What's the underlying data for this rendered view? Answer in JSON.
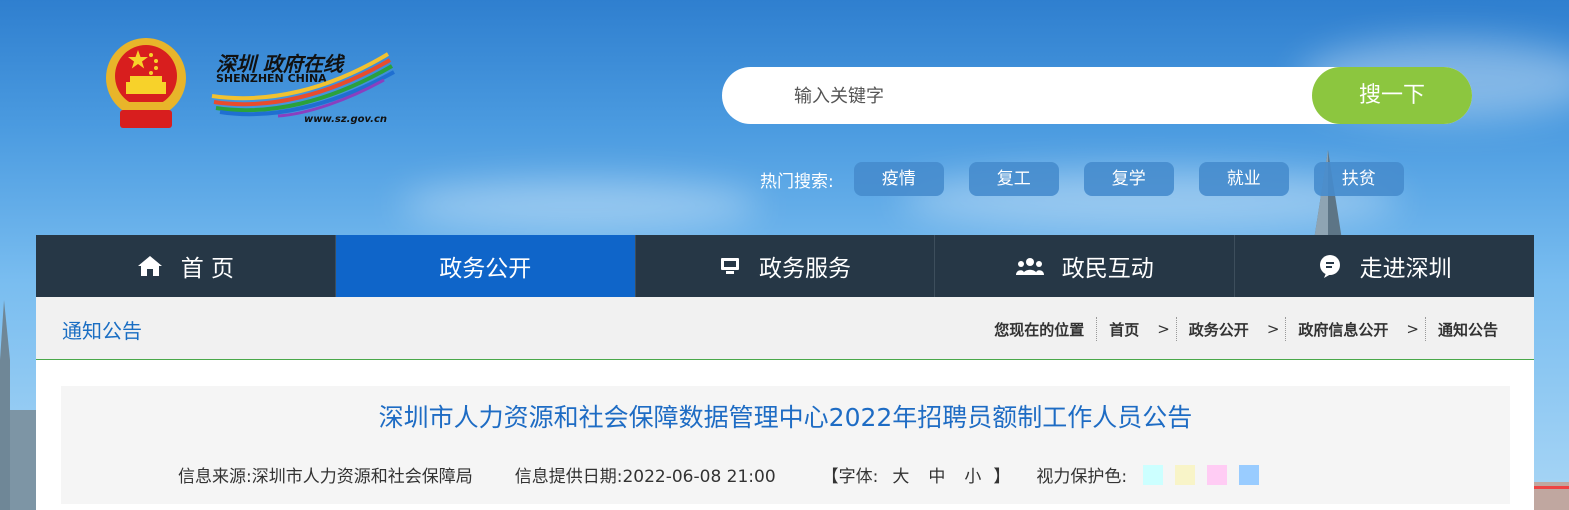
{
  "site": {
    "logo_cn": "深圳 政府在线",
    "logo_en": "SHENZHEN CHINA",
    "logo_url": "www.sz.gov.cn"
  },
  "search": {
    "placeholder": "输入关键字",
    "button_label": "搜一下"
  },
  "hot_search": {
    "label": "热门搜索:",
    "tags": [
      "疫情",
      "复工",
      "复学",
      "就业",
      "扶贫"
    ]
  },
  "nav": {
    "items": [
      {
        "label": "首 页",
        "icon": "home-icon"
      },
      {
        "label": "政务公开",
        "icon": ""
      },
      {
        "label": "政务服务",
        "icon": "monitor-icon"
      },
      {
        "label": "政民互动",
        "icon": "users-icon"
      },
      {
        "label": "走进深圳",
        "icon": "chat-icon"
      }
    ],
    "active_index": 1
  },
  "breadcrumb": {
    "section_title": "通知公告",
    "location_label": "您现在的位置",
    "items": [
      "首页",
      "政务公开",
      "政府信息公开",
      "通知公告"
    ],
    "separator": ">"
  },
  "article": {
    "title": "深圳市人力资源和社会保障数据管理中心2022年招聘员额制工作人员公告",
    "source_label": "信息来源:深圳市人力资源和社会保障局",
    "date_label": "信息提供日期:2022-06-08 21:00",
    "font_open": "【字体:",
    "font_large": "大",
    "font_medium": "中",
    "font_small": "小",
    "font_close": "】",
    "eye_label": "视力保护色:",
    "eye_colors": [
      "#ccffff",
      "#f8f4c8",
      "#ffccf4",
      "#99ccff"
    ]
  },
  "colors": {
    "accent_blue": "#0f65c9",
    "nav_dark": "#263746",
    "search_green": "#8cc63f",
    "title_blue": "#1e6cc4"
  }
}
